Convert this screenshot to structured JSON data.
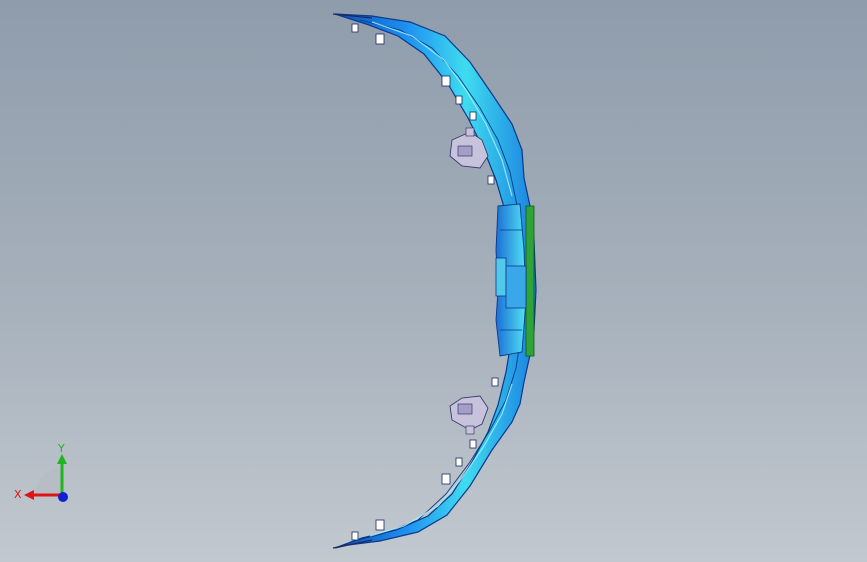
{
  "viewport": {
    "colors": {
      "background_top": "#8f9cab",
      "background_bottom": "#c2c8cf",
      "part_blue": "#1f86e8",
      "part_cyan": "#35d6ea",
      "part_dark": "#0b3f9a",
      "part_green": "#2fa33a",
      "bracket_lilac": "#c8c3dd"
    },
    "model": {
      "name_icon": "front-bumper-fascia-model"
    }
  },
  "triad": {
    "x_label": "X",
    "y_label": "Y",
    "x_color": "#e01414",
    "y_color": "#1fb524",
    "z_color": "#1020d0"
  }
}
